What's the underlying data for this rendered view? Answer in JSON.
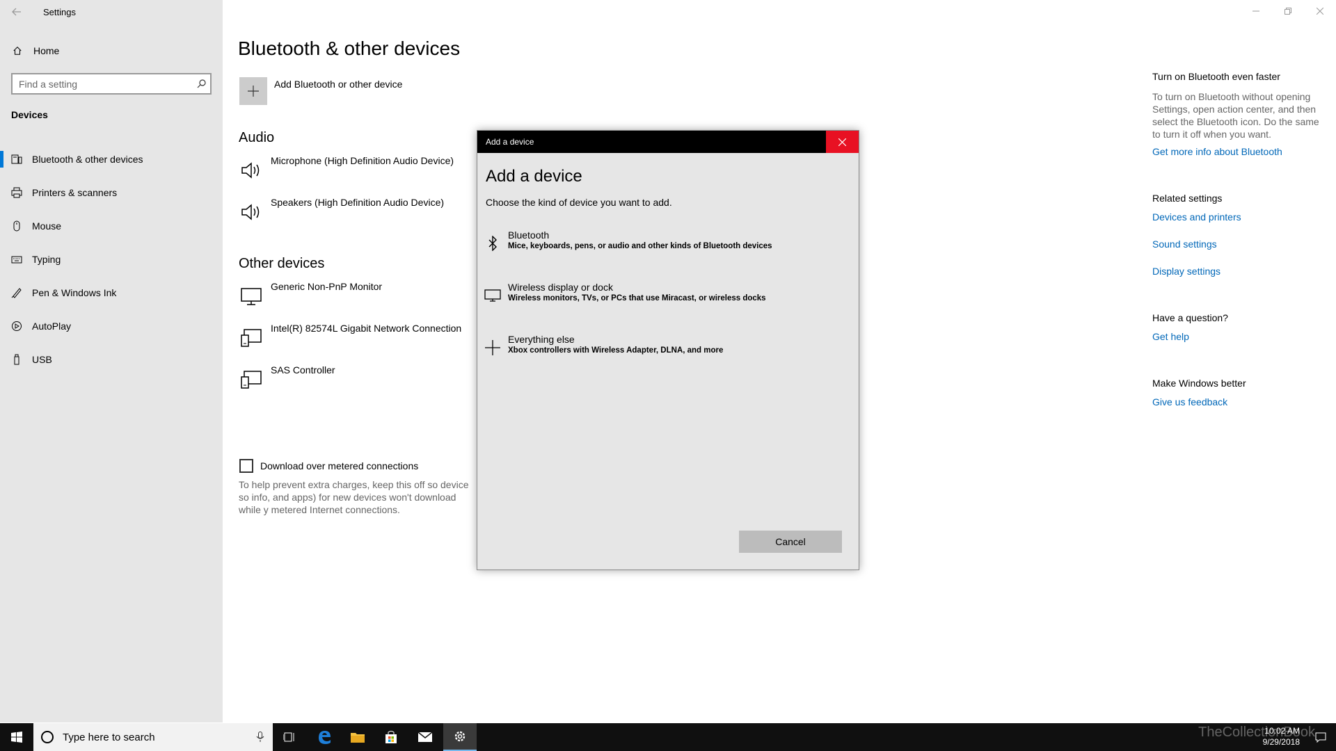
{
  "window": {
    "title": "Settings",
    "controls": [
      "minimize",
      "maximize",
      "close"
    ]
  },
  "sidebar": {
    "home_label": "Home",
    "search_placeholder": "Find a setting",
    "section_label": "Devices",
    "items": [
      {
        "label": "Bluetooth & other devices",
        "icon": "bluetooth-devices-icon",
        "active": true
      },
      {
        "label": "Printers & scanners",
        "icon": "printer-icon",
        "active": false
      },
      {
        "label": "Mouse",
        "icon": "mouse-icon",
        "active": false
      },
      {
        "label": "Typing",
        "icon": "keyboard-icon",
        "active": false
      },
      {
        "label": "Pen & Windows Ink",
        "icon": "pen-icon",
        "active": false
      },
      {
        "label": "AutoPlay",
        "icon": "autoplay-icon",
        "active": false
      },
      {
        "label": "USB",
        "icon": "usb-icon",
        "active": false
      }
    ]
  },
  "main": {
    "title": "Bluetooth & other devices",
    "add_device_label": "Add Bluetooth or other device",
    "audio_heading": "Audio",
    "audio_devices": [
      {
        "name": "Microphone (High Definition Audio Device)",
        "icon": "speaker-icon"
      },
      {
        "name": "Speakers (High Definition Audio Device)",
        "icon": "speaker-icon"
      }
    ],
    "other_heading": "Other devices",
    "other_devices": [
      {
        "name": "Generic Non-PnP Monitor",
        "icon": "monitor-icon"
      },
      {
        "name": "Intel(R) 82574L Gigabit Network Connection",
        "icon": "device-icon"
      },
      {
        "name": "SAS Controller",
        "icon": "device-icon"
      }
    ],
    "metered_label": "Download over metered connections",
    "metered_checked": false,
    "metered_desc": "To help prevent extra charges, keep this off so device so info, and apps) for new devices won't download while y metered Internet connections."
  },
  "right_panel": {
    "bt_heading": "Turn on Bluetooth even faster",
    "bt_text": "To turn on Bluetooth without opening Settings, open action center, and then select the Bluetooth icon. Do the same to turn it off when you want.",
    "bt_link": "Get more info about Bluetooth",
    "related_heading": "Related settings",
    "related_links": [
      "Devices and printers",
      "Sound settings",
      "Display settings"
    ],
    "question_heading": "Have a question?",
    "question_link": "Get help",
    "better_heading": "Make Windows better",
    "better_link": "Give us feedback",
    "link_color": "#0067b8"
  },
  "dialog": {
    "title": "Add a device",
    "heading": "Add a device",
    "subtitle": "Choose the kind of device you want to add.",
    "options": [
      {
        "title": "Bluetooth",
        "desc": "Mice, keyboards, pens, or audio and other kinds of Bluetooth devices",
        "icon": "bluetooth-icon"
      },
      {
        "title": "Wireless display or dock",
        "desc": "Wireless monitors, TVs, or PCs that use Miracast, or wireless docks",
        "icon": "monitor-icon"
      },
      {
        "title": "Everything else",
        "desc": "Xbox controllers with Wireless Adapter, DLNA, and more",
        "icon": "plus-icon"
      }
    ],
    "cancel_label": "Cancel",
    "close_color": "#e81123"
  },
  "taskbar": {
    "search_placeholder": "Type here to search",
    "apps": [
      "task-view-icon",
      "edge-icon",
      "file-explorer-icon",
      "store-icon",
      "mail-icon",
      "settings-icon"
    ],
    "time": "10:02 AM",
    "date": "9/29/2018",
    "watermark": "TheCollectionBook"
  }
}
